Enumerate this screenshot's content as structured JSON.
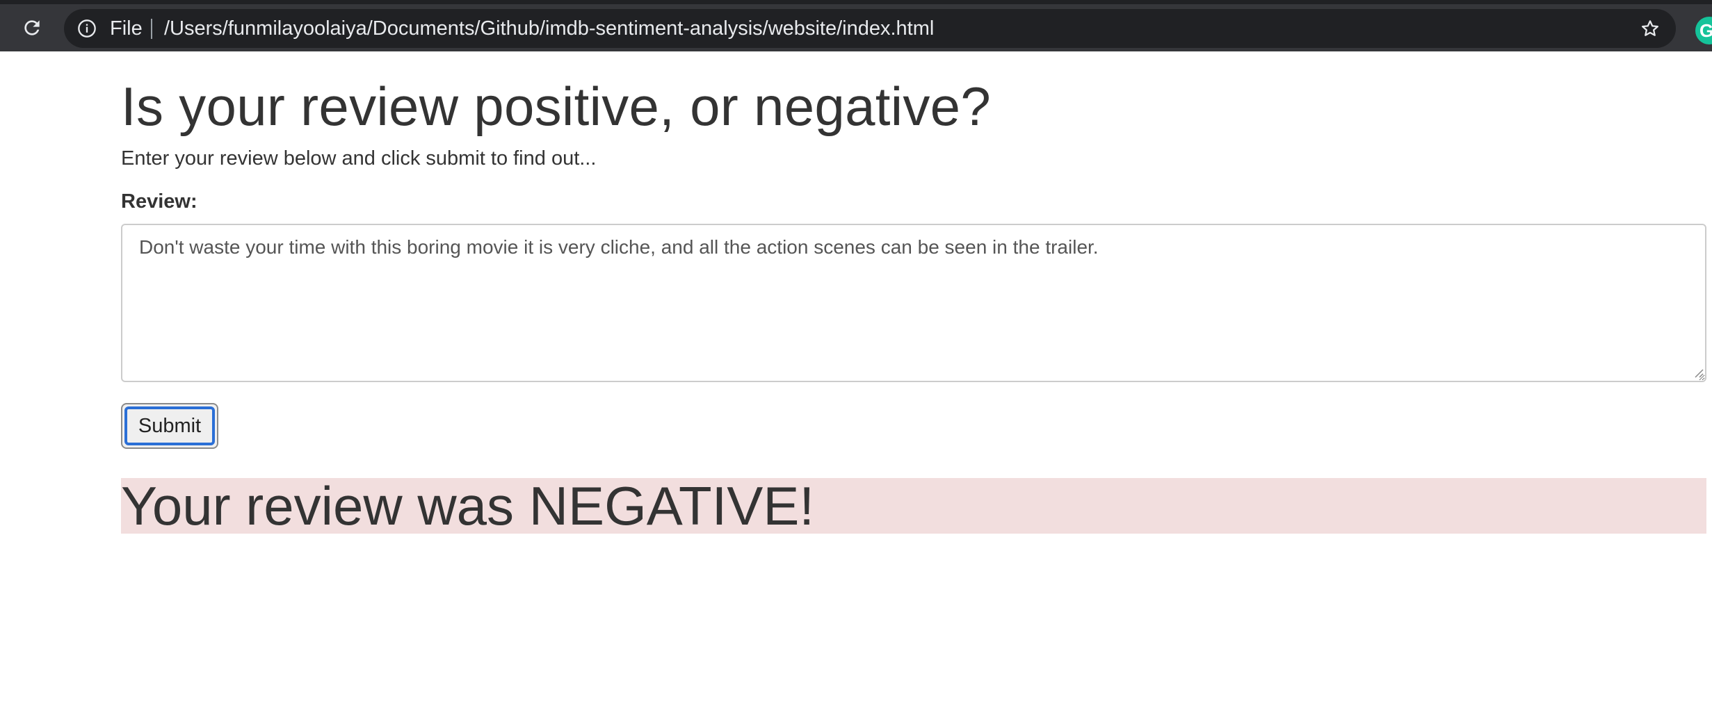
{
  "browser": {
    "scheme_label": "File",
    "url": "/Users/funmilayoolaiya/Documents/Github/imdb-sentiment-analysis/website/index.html",
    "extension_letter": "G",
    "icons": {
      "reload": "reload-icon",
      "info": "info-icon",
      "star": "star-icon",
      "extension": "grammarly-icon"
    }
  },
  "page": {
    "title": "Is your review positive, or negative?",
    "subtitle": "Enter your review below and click submit to find out...",
    "review_label": "Review:",
    "review_text": "Don't waste your time with this boring movie it is very cliche, and all the action scenes can be seen in the trailer.",
    "submit_label": "Submit",
    "result_text": "Your review was NEGATIVE!"
  },
  "colors": {
    "result_background": "#f2dede",
    "text": "#333333",
    "focus_ring": "#2b6fd6"
  }
}
